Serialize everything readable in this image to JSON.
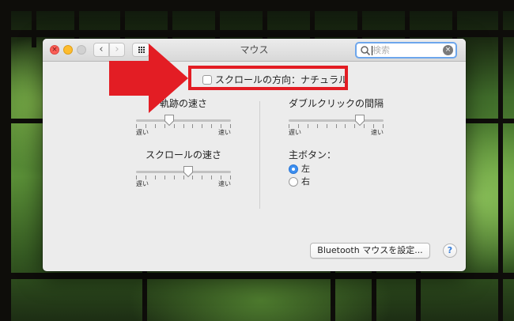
{
  "window": {
    "title": "マウス"
  },
  "search": {
    "placeholder": "検索",
    "clear_glyph": "×"
  },
  "nav": {
    "back": "‹",
    "forward": "›"
  },
  "scroll_direction": {
    "label": "スクロールの方向：ナチュラル",
    "checked": false
  },
  "tracking": {
    "title": "軌跡の速さ",
    "min_label": "遅い",
    "max_label": "速い",
    "value": 0.35
  },
  "scrolling": {
    "title": "スクロールの速さ",
    "min_label": "遅い",
    "max_label": "速い",
    "value": 0.55
  },
  "double_click": {
    "title": "ダブルクリックの間隔",
    "min_label": "遅い",
    "max_label": "速い",
    "value": 0.75
  },
  "primary_button": {
    "title": "主ボタン：",
    "options": [
      {
        "label": "左",
        "selected": true
      },
      {
        "label": "右",
        "selected": false
      }
    ]
  },
  "bluetooth_button": {
    "label": "Bluetooth マウスを設定..."
  },
  "help_button": {
    "label": "?"
  },
  "annotation": {
    "color": "#e31d24"
  },
  "colors": {
    "accent": "#3d8ff0",
    "close": "#fc5f57",
    "minimize": "#fdbc2e"
  }
}
